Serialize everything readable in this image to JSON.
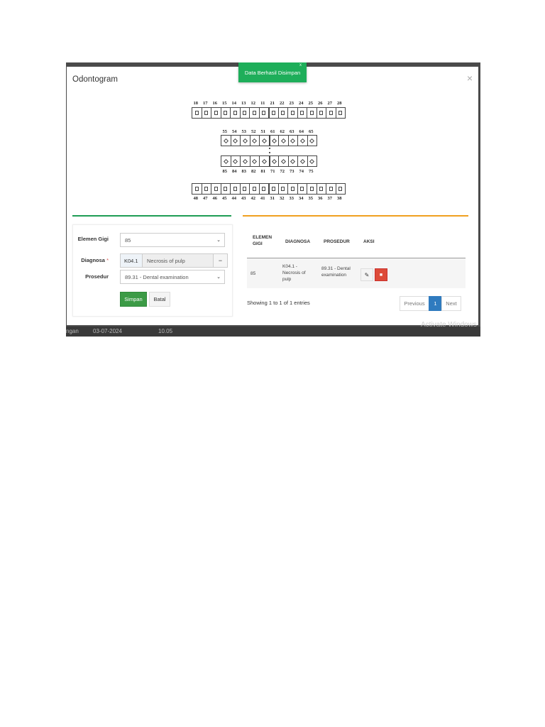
{
  "modal": {
    "title": "Odontogram",
    "close": "×"
  },
  "toast": {
    "message": "Data Berhasil Disimpan",
    "close": "x"
  },
  "odontogram": {
    "upper_permanent": [
      "18",
      "17",
      "16",
      "15",
      "14",
      "13",
      "12",
      "11",
      "21",
      "22",
      "23",
      "24",
      "25",
      "26",
      "27",
      "28"
    ],
    "upper_primary": [
      "55",
      "54",
      "53",
      "52",
      "51",
      "61",
      "62",
      "63",
      "64",
      "65"
    ],
    "lower_primary": [
      "85",
      "84",
      "83",
      "82",
      "81",
      "71",
      "72",
      "73",
      "74",
      "75"
    ],
    "lower_permanent": [
      "48",
      "47",
      "46",
      "45",
      "44",
      "43",
      "42",
      "41",
      "31",
      "32",
      "33",
      "34",
      "35",
      "36",
      "37",
      "38"
    ]
  },
  "form": {
    "elemen_label": "Elemen Gigi",
    "elemen_value": "85",
    "diagnosa_label": "Diagnosa",
    "diagnosa_required": "*",
    "diagnosa_code": "K04.1",
    "diagnosa_name": "Necrosis of pulp",
    "diagnosa_clear": "−",
    "prosedur_label": "Prosedur",
    "prosedur_value": "89.31 - Dental examination",
    "simpan_label": "Simpan",
    "batal_label": "Batal"
  },
  "table": {
    "headers": [
      "ELEMEN GIGI",
      "DIAGNOSA",
      "PROSEDUR",
      "AKSI"
    ],
    "rows": [
      {
        "elemen": "85",
        "diagnosa": "K04.1 - Necrosis of pulp",
        "prosedur": "89.31 - Dental examination"
      }
    ],
    "showing": "Showing 1 to 1 of 1 entries",
    "pagination": {
      "previous": "Previous",
      "current": "1",
      "next": "Next"
    }
  },
  "watermark": "Activate Windows",
  "background": {
    "partial_label": "ngan",
    "partial_date": "03-07-2024",
    "partial_time": "10.05"
  }
}
